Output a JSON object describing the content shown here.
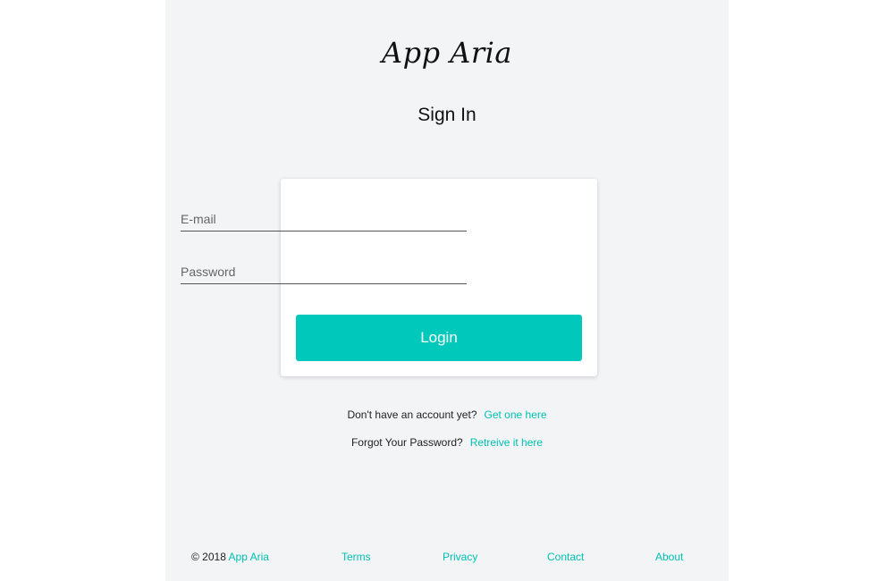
{
  "brand": {
    "logo_text": "App Aria"
  },
  "page": {
    "title": "Sign In"
  },
  "form": {
    "email": {
      "placeholder": "E-mail",
      "value": ""
    },
    "password": {
      "placeholder": "Password",
      "value": ""
    },
    "login_label": "Login"
  },
  "prompts": {
    "signup": {
      "text": "Don't have an account yet?",
      "link": "Get one here"
    },
    "forgot": {
      "text": "Forgot Your Password?",
      "link": "Retreive it here"
    }
  },
  "footer": {
    "copyright_prefix": "© 2018",
    "copyright_brand": "App Aria",
    "links": {
      "terms": "Terms",
      "privacy": "Privacy",
      "contact": "Contact",
      "about": "About"
    }
  },
  "colors": {
    "accent": "#00c9bb",
    "link": "#00c0b3",
    "panel_background": "#f3f4f6",
    "card_background": "#ffffff"
  }
}
